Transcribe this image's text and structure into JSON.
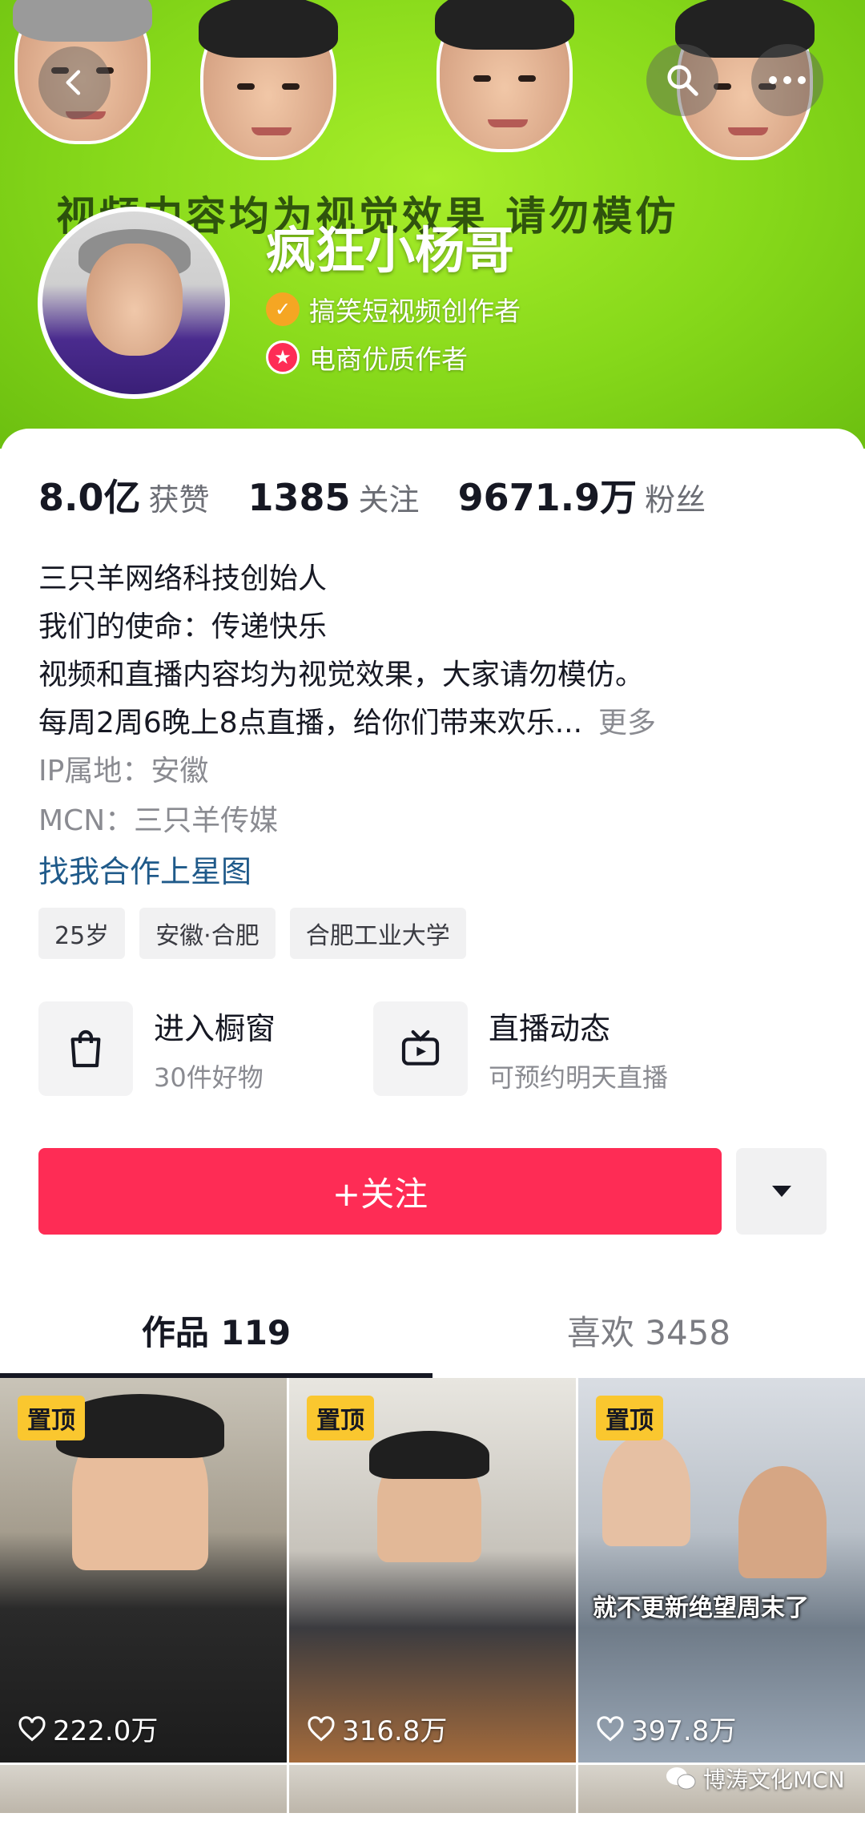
{
  "header": {
    "banner_text": "视频内容均为视觉效果 请勿模仿",
    "nickname": "疯狂小杨哥",
    "badges": [
      {
        "label": "搞笑短视频创作者",
        "icon": "verified-check-icon",
        "color": "#f5a623"
      },
      {
        "label": "电商优质作者",
        "icon": "star-badge-icon",
        "color": "#fe2c55"
      }
    ]
  },
  "stats": [
    {
      "value": "8.0亿",
      "label": "获赞"
    },
    {
      "value": "1385",
      "label": "关注"
    },
    {
      "value": "9671.9万",
      "label": "粉丝"
    }
  ],
  "bio": {
    "lines": [
      "三只羊网络科技创始人",
      "我们的使命：传递快乐",
      "视频和直播内容均为视觉效果，大家请勿模仿。",
      "每周2周6晚上8点直播，给你们带来欢乐..."
    ],
    "more_label": "更多",
    "ip": "IP属地：安徽",
    "mcn": "MCN：三只羊传媒",
    "starmap_link": "找我合作上星图"
  },
  "tags": [
    "25岁",
    "安徽·合肥",
    "合肥工业大学"
  ],
  "shortcuts": [
    {
      "title": "进入橱窗",
      "subtitle": "30件好物",
      "icon": "shopping-bag-icon"
    },
    {
      "title": "直播动态",
      "subtitle": "可预约明天直播",
      "icon": "tv-live-icon"
    }
  ],
  "actions": {
    "follow_label": "+关注",
    "dropdown_icon": "caret-down-icon",
    "accent": "#fe2c55"
  },
  "tabs": [
    {
      "label": "作品 119",
      "active": true
    },
    {
      "label": "喜欢 3458",
      "active": false
    }
  ],
  "videos": [
    {
      "pinned_label": "置顶",
      "likes": "222.0万",
      "caption": ""
    },
    {
      "pinned_label": "置顶",
      "likes": "316.8万",
      "caption": ""
    },
    {
      "pinned_label": "置顶",
      "likes": "397.8万",
      "caption": "就不更新绝望周末了"
    }
  ],
  "watermark": "博涛文化MCN"
}
